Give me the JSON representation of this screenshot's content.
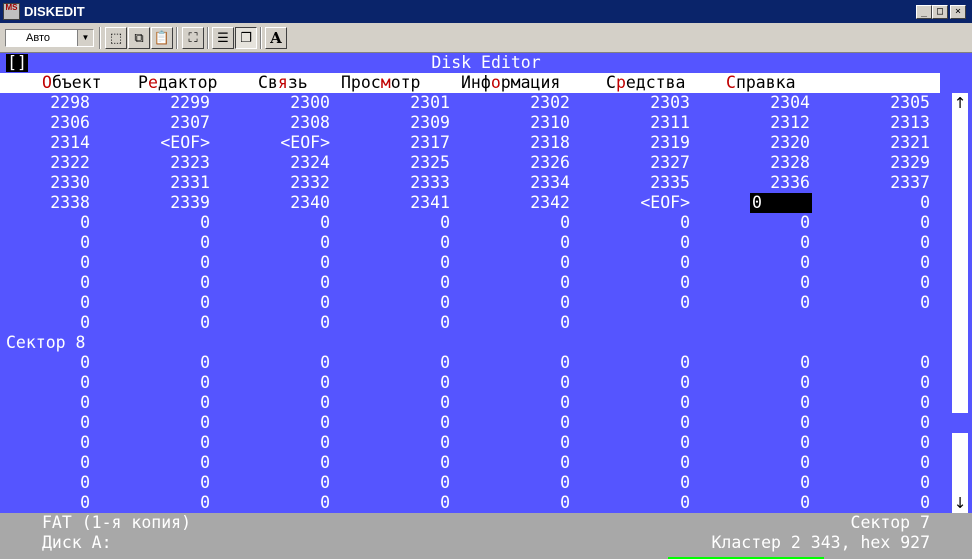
{
  "window": {
    "title": "DISKEDIT",
    "app_icon_label": "MS"
  },
  "toolbar": {
    "font_select_value": "Авто",
    "font_button_label": "A"
  },
  "screen": {
    "title": "Disk Editor",
    "close_box": "[]",
    "menu": [
      {
        "hot": "О",
        "rest": "бъект"
      },
      {
        "pre": "Р",
        "hot": "е",
        "rest": "дактор"
      },
      {
        "pre": "Св",
        "hot": "я",
        "rest": "зь"
      },
      {
        "pre": "Прос",
        "hot": "м",
        "rest": "отр"
      },
      {
        "pre": "Инф",
        "hot": "о",
        "rest": "рмация"
      },
      {
        "pre": "С",
        "hot": "р",
        "rest": "едства"
      },
      {
        "hot": "С",
        "rest": "правка"
      }
    ],
    "sector_label": "Сектор 8",
    "rows_before": [
      [
        "2298",
        "2299",
        "2300",
        "2301",
        "2302",
        "2303",
        "2304",
        "2305"
      ],
      [
        "2306",
        "2307",
        "2308",
        "2309",
        "2310",
        "2311",
        "2312",
        "2313"
      ],
      [
        "2314",
        "<EOF>",
        "<EOF>",
        "2317",
        "2318",
        "2319",
        "2320",
        "2321"
      ],
      [
        "2322",
        "2323",
        "2324",
        "2325",
        "2326",
        "2327",
        "2328",
        "2329"
      ],
      [
        "2330",
        "2331",
        "2332",
        "2333",
        "2334",
        "2335",
        "2336",
        "2337"
      ],
      [
        "2338",
        "2339",
        "2340",
        "2341",
        "2342",
        "<EOF>",
        "0",
        "0"
      ],
      [
        "0",
        "0",
        "0",
        "0",
        "0",
        "0",
        "0",
        "0"
      ],
      [
        "0",
        "0",
        "0",
        "0",
        "0",
        "0",
        "0",
        "0"
      ],
      [
        "0",
        "0",
        "0",
        "0",
        "0",
        "0",
        "0",
        "0"
      ],
      [
        "0",
        "0",
        "0",
        "0",
        "0",
        "0",
        "0",
        "0"
      ],
      [
        "0",
        "0",
        "0",
        "0",
        "0",
        "0",
        "0",
        "0"
      ],
      [
        "0",
        "0",
        "0",
        "0",
        "0"
      ]
    ],
    "selected_cell": {
      "row": 5,
      "col": 6
    },
    "rows_after": [
      [
        "0",
        "0",
        "0",
        "0",
        "0",
        "0",
        "0",
        "0"
      ],
      [
        "0",
        "0",
        "0",
        "0",
        "0",
        "0",
        "0",
        "0"
      ],
      [
        "0",
        "0",
        "0",
        "0",
        "0",
        "0",
        "0",
        "0"
      ],
      [
        "0",
        "0",
        "0",
        "0",
        "0",
        "0",
        "0",
        "0"
      ],
      [
        "0",
        "0",
        "0",
        "0",
        "0",
        "0",
        "0",
        "0"
      ],
      [
        "0",
        "0",
        "0",
        "0",
        "0",
        "0",
        "0",
        "0"
      ],
      [
        "0",
        "0",
        "0",
        "0",
        "0",
        "0",
        "0",
        "0"
      ],
      [
        "0",
        "0",
        "0",
        "0",
        "0",
        "0",
        "0",
        "0"
      ]
    ]
  },
  "status": {
    "object": "FAT (1-я копия)",
    "sector": "Сектор 7",
    "disk": "Диск A:",
    "cluster": "Кластер 2 343, hex 927"
  },
  "colors": {
    "screen_bg": "#5555ff",
    "menu_hotkey": "#c00000",
    "status_bg": "#a8a8a8"
  }
}
